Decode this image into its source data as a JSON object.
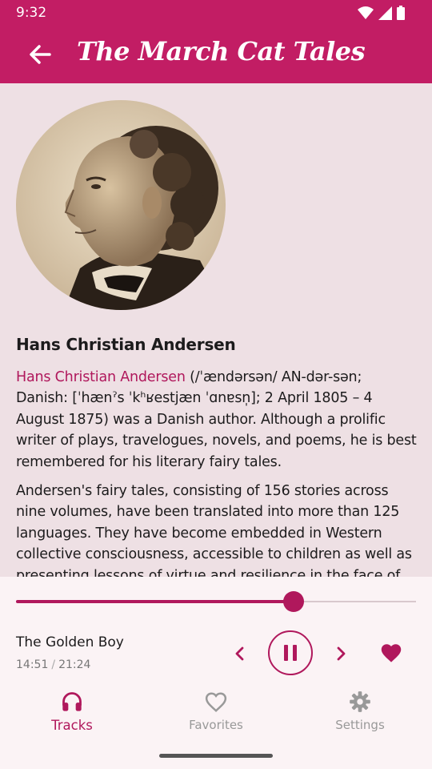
{
  "status_bar": {
    "time": "9:32",
    "icons": [
      "wifi-icon",
      "signal-icon",
      "battery-icon"
    ]
  },
  "app_bar": {
    "back_icon": "arrow-left-icon",
    "title": "The March Cat Tales"
  },
  "author": {
    "portrait": "author-portrait",
    "name": "Hans Christian Andersen",
    "bio_link": "Hans Christian Andersen",
    "bio_p1": " (/ˈændərsən/ AN-dər-sən; Danish: [ˈhænˀs ˈkʰʁestjæn ˈɑnɐsn̩]; 2 April 1805 – 4 August 1875) was a Danish author. Although a prolific writer of plays, travelogues, novels, and poems, he is best remembered for his literary fairy tales.",
    "bio_p2": "Andersen's fairy tales, consisting of 156 stories across nine volumes, have been translated into more than 125 languages. They have become embedded in Western collective consciousness, accessible to children as well as presenting lessons of virtue and resilience in the face of adversity for mature readers."
  },
  "player": {
    "track_title": "The Golden Boy",
    "elapsed": "14:51",
    "separator": "/",
    "duration": "21:24",
    "progress": 0.694,
    "controls": [
      "chevron-left-icon",
      "pause-icon",
      "chevron-right-icon",
      "heart-icon"
    ],
    "favorite": true
  },
  "bottom_nav": {
    "items": [
      {
        "label": "Tracks",
        "icon": "headphones-icon",
        "active": true
      },
      {
        "label": "Favorites",
        "icon": "heart-outline-icon",
        "active": false
      },
      {
        "label": "Settings",
        "icon": "gear-icon",
        "active": false
      }
    ]
  },
  "colors": {
    "primary": "#c21d64",
    "accent": "#b0185c",
    "background": "#eee0e4",
    "surface": "#fbf3f5"
  }
}
